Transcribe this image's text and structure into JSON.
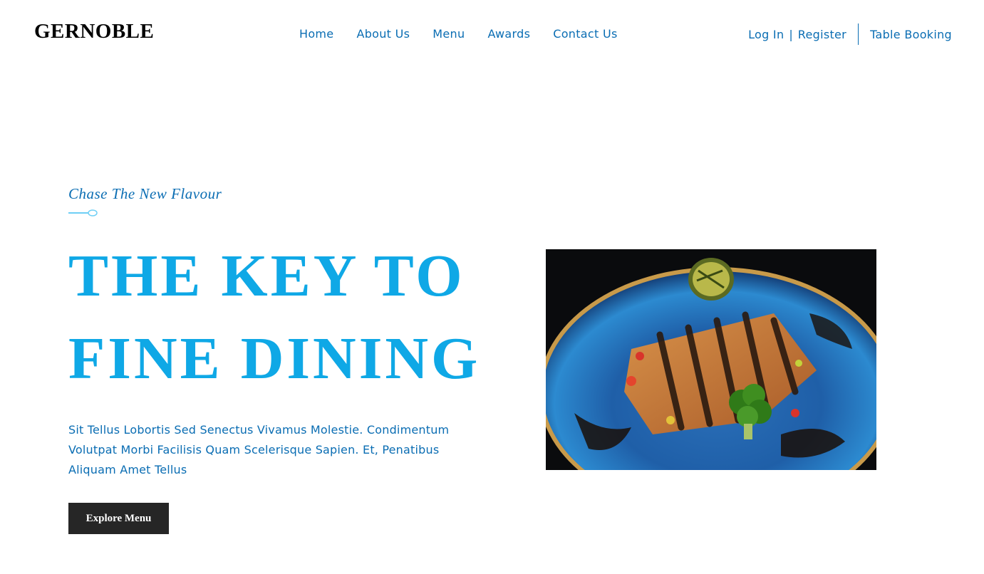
{
  "header": {
    "logo": "GERNOBLE",
    "nav": [
      {
        "label": "Home"
      },
      {
        "label": "About Us"
      },
      {
        "label": "Menu"
      },
      {
        "label": "Awards"
      },
      {
        "label": "Contact Us"
      }
    ],
    "login_label": "Log In",
    "divider": "|",
    "register_label": "Register",
    "booking_label": "Table Booking"
  },
  "hero": {
    "tagline": "Chase The New Flavour",
    "headline_line1": "THE KEY TO",
    "headline_line2": "FINE DINING",
    "description": "Sit Tellus Lobortis Sed Senectus Vivamus Molestie. Condimentum Volutpat Morbi Facilisis Quam Scelerisque Sapien. Et, Penatibus Aliquam Amet Tellus",
    "cta_label": "Explore Menu",
    "image_icon": "grilled-fish-dish-photo"
  },
  "colors": {
    "accent": "#0fa8e6",
    "link": "#0a6db3",
    "button_bg": "#262626"
  }
}
